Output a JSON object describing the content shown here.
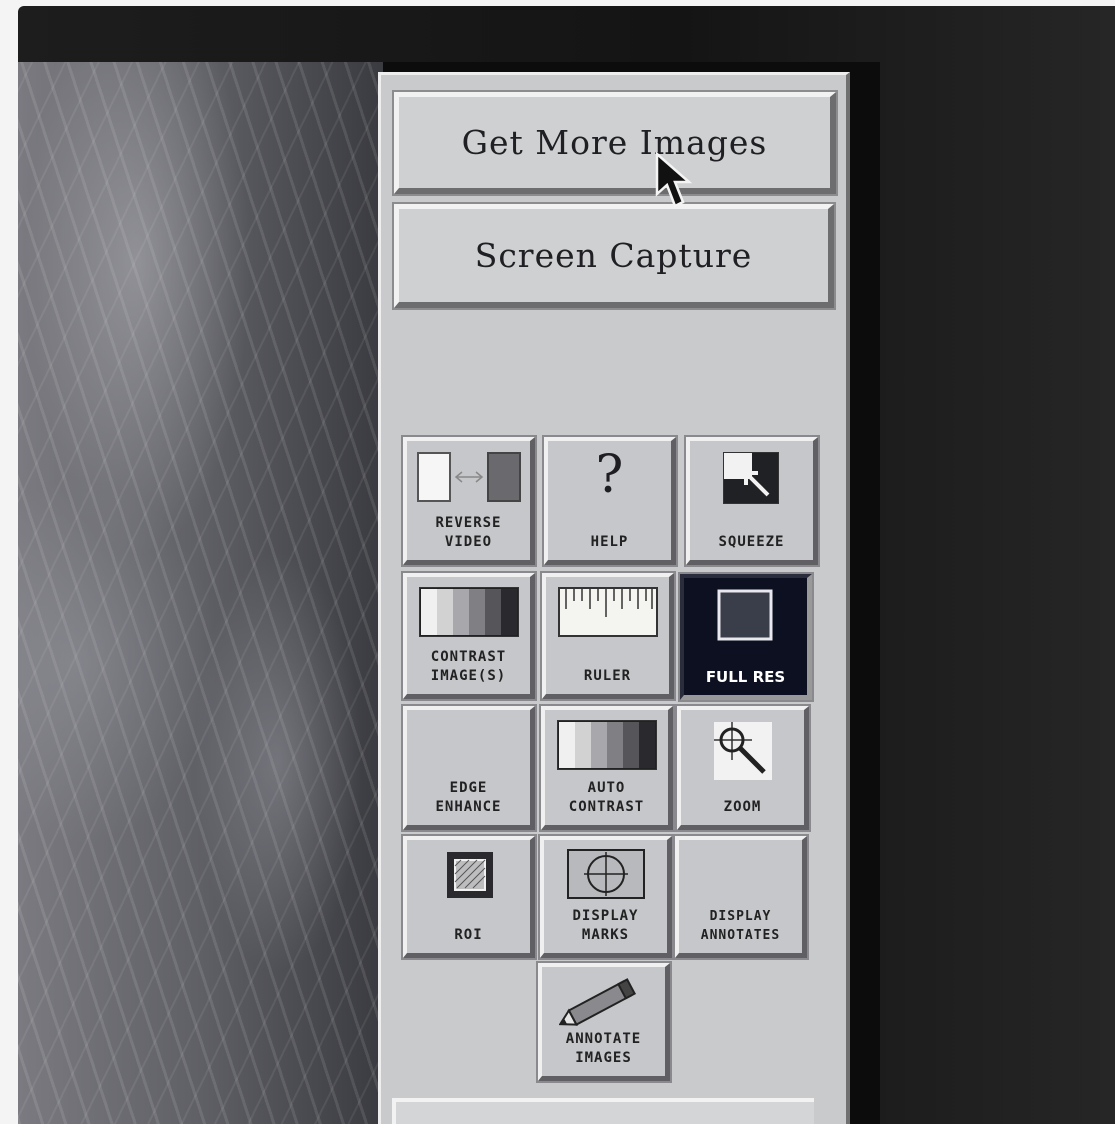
{
  "panel": {
    "buttons": {
      "get_more_images": "Get More Images",
      "screen_capture": "Screen Capture"
    },
    "tools": [
      {
        "label": "REVERSE\nVIDEO",
        "icon": "reverse-video-icon"
      },
      {
        "label": "HELP",
        "icon": "question-mark-icon",
        "glyph": "?"
      },
      {
        "label": "SQUEEZE",
        "icon": "squeeze-icon"
      },
      {
        "label": "CONTRAST\nIMAGE(S)",
        "icon": "contrast-gradient-icon"
      },
      {
        "label": "RULER",
        "icon": "ruler-icon"
      },
      {
        "label": "FULL RES",
        "icon": "full-res-icon",
        "active": true
      },
      {
        "label": "EDGE\nENHANCE",
        "icon": ""
      },
      {
        "label": "AUTO\nCONTRAST",
        "icon": "auto-contrast-icon"
      },
      {
        "label": "ZOOM",
        "icon": "magnifier-icon"
      },
      {
        "label": "ROI",
        "icon": "roi-icon"
      },
      {
        "label": "DISPLAY\nMARKS",
        "icon": "crosshair-icon"
      },
      {
        "label": "DISPLAY\nANNOTATES",
        "icon": ""
      },
      {
        "label": "ANNOTATE\nIMAGES",
        "icon": "pencil-icon"
      }
    ]
  },
  "colors": {
    "panel_bg": "#c9cacc",
    "active_tool_bg": "#0d1020",
    "bezel": "#141414"
  }
}
